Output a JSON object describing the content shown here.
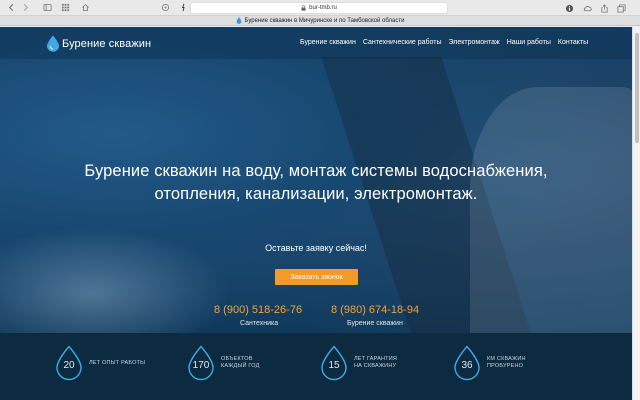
{
  "browser": {
    "url": "bur-tmb.ru",
    "tab_title": "Бурение скважин в Мичуринске и по Тамбовской области"
  },
  "colors": {
    "accent": "#f39a2b",
    "header_bg": "#0c2a40",
    "drop_blue": "#41a9e6"
  },
  "site": {
    "logo_text": "Бурение скважин",
    "nav": [
      {
        "label": "Бурение скважин"
      },
      {
        "label": "Сантехнические работы"
      },
      {
        "label": "Электромонтаж"
      },
      {
        "label": "Наши работы"
      },
      {
        "label": "Контакты"
      }
    ],
    "hero": {
      "headline_line1": "Бурение скважин на воду, монтаж системы водоснабжения,",
      "headline_line2": "отопления, канализации, электромонтаж.",
      "cta_text": "Оставьте заявку сейчас!",
      "cta_button": "Заказать звонок"
    },
    "phones": [
      {
        "number": "8 (900) 518-26-76",
        "caption": "Сантехника"
      },
      {
        "number": "8 (980) 674-18-94",
        "caption": "Бурение скважин"
      }
    ],
    "stats": [
      {
        "value": "20",
        "line1": "ЛЕТ ОПЫТ РАБОТЫ",
        "line2": ""
      },
      {
        "value": "170",
        "line1": "ОБЪЕКТОВ",
        "line2": "КАЖДЫЙ ГОД"
      },
      {
        "value": "15",
        "line1": "ЛЕТ ГАРАНТИЯ",
        "line2": "НА СКВАЖИНУ"
      },
      {
        "value": "36",
        "line1": "КМ СКВАЖИН",
        "line2": "ПРОБУРЕНО"
      }
    ]
  }
}
